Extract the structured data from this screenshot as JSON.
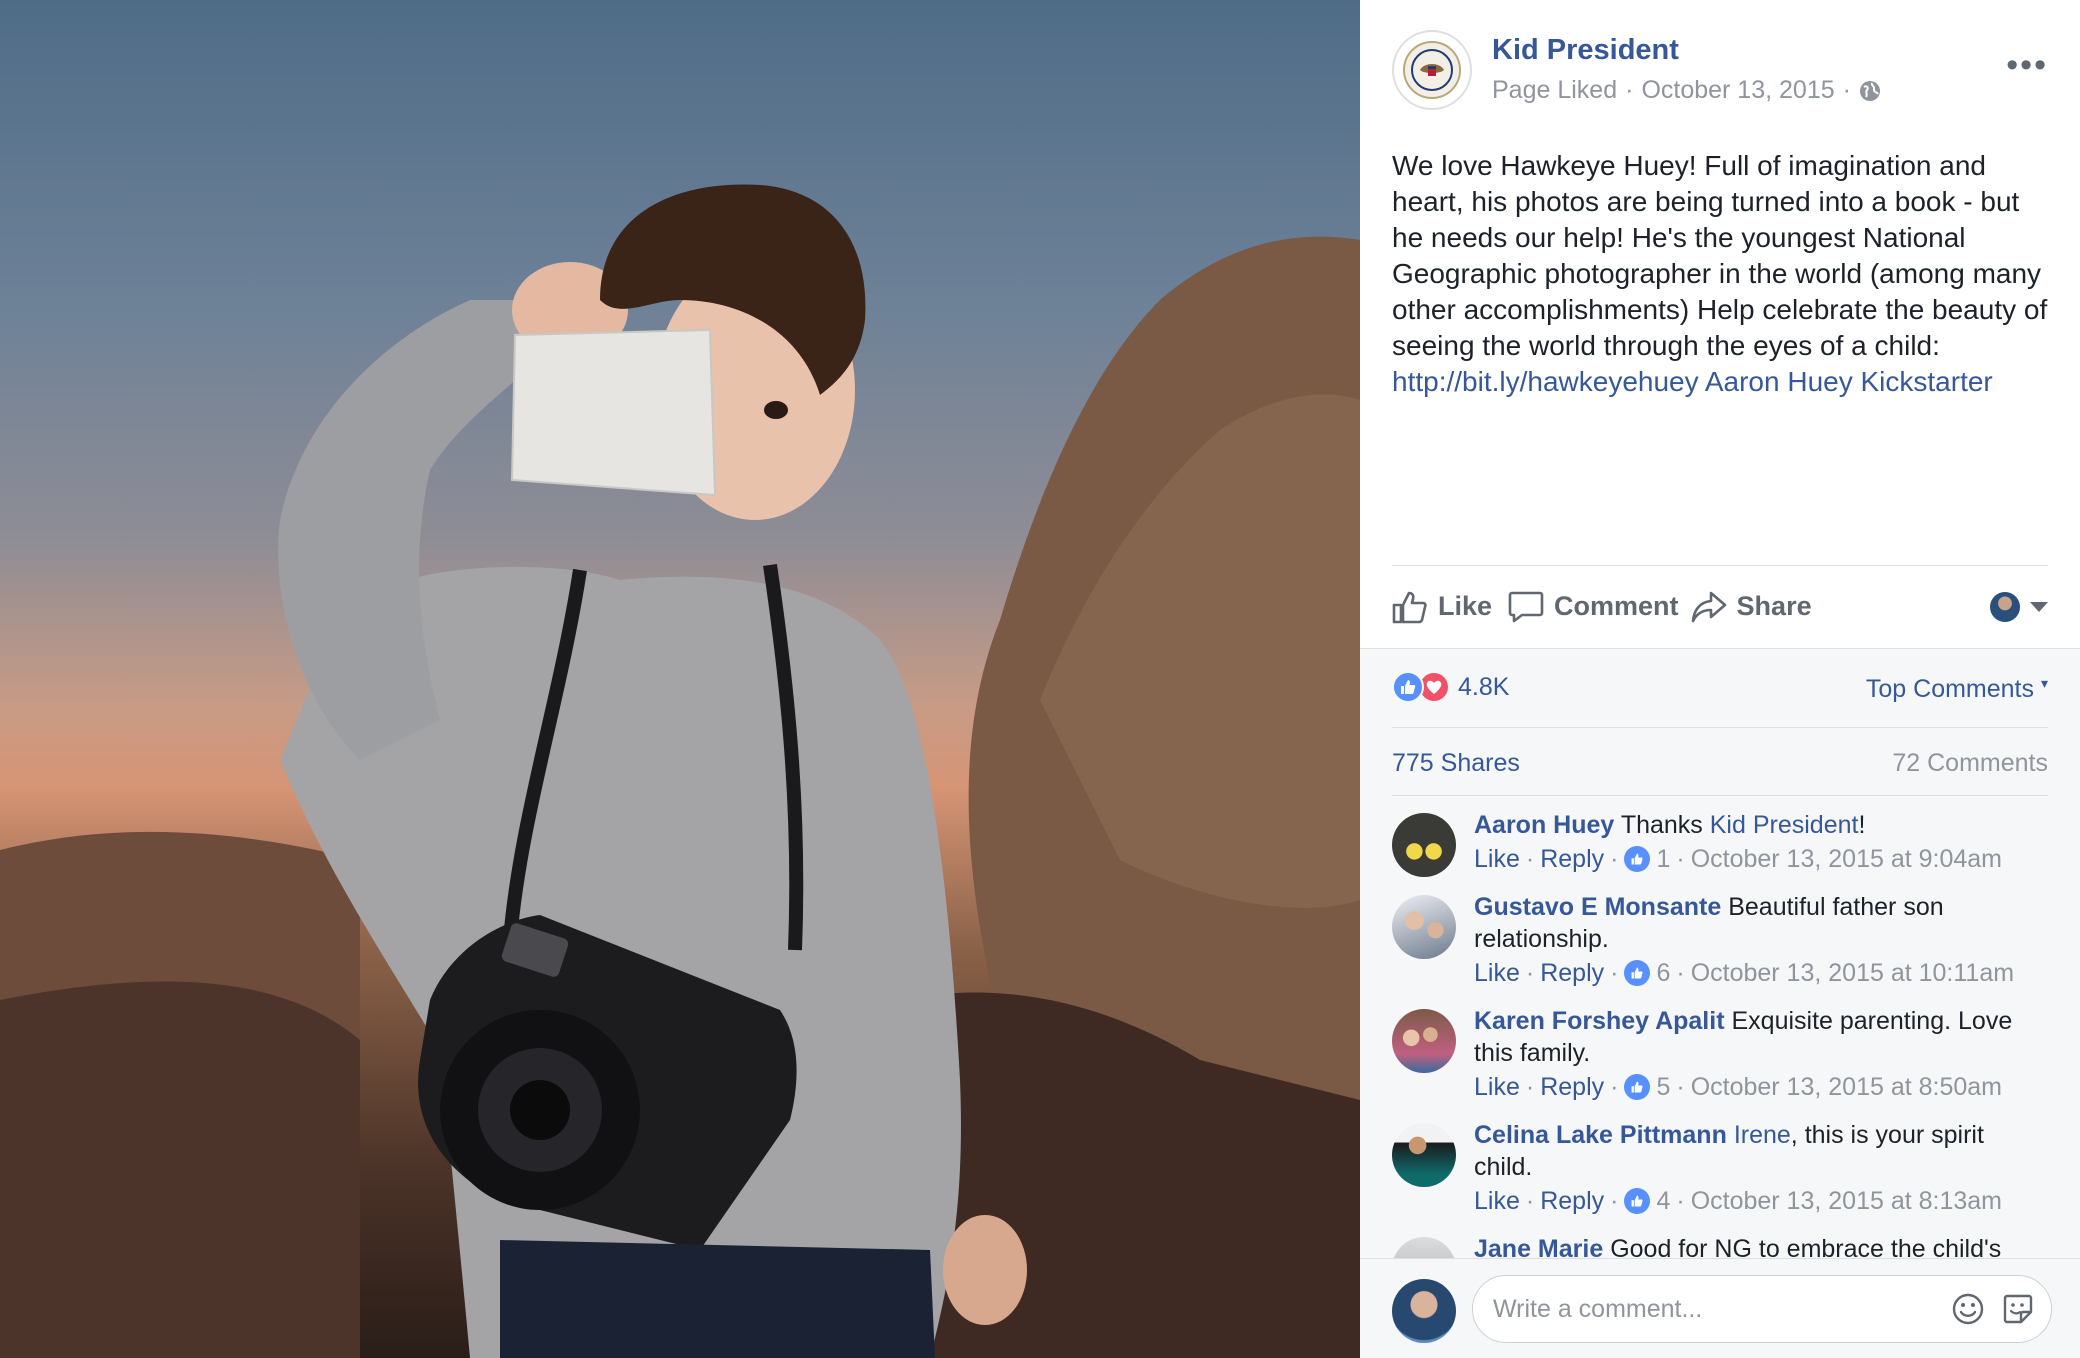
{
  "post": {
    "page_name": "Kid President",
    "meta_status": "Page Liked",
    "meta_sep": "·",
    "date": "October 13, 2015",
    "privacy_icon": "globe-icon",
    "more_label": "•••",
    "text": "We love Hawkeye Huey! Full of imagination and heart, his photos are being turned into a book - but he needs our help! He's the youngest National Geographic photographer in the world (among many other accomplishments) Help celebrate the beauty of seeing the world through the eyes of a child: ",
    "link_url": "http://bit.ly/hawkeyehuey",
    "link_tags": "Aaron Huey Kickstarter"
  },
  "actions": {
    "like": "Like",
    "comment": "Comment",
    "share": "Share"
  },
  "stats": {
    "reactions_count": "4.8K",
    "sort_label": "Top Comments",
    "shares": "775 Shares",
    "comments": "72 Comments"
  },
  "comments": [
    {
      "name": "Aaron Huey",
      "text_before": "Thanks ",
      "mention": "Kid President",
      "text_after": "!",
      "like": "Like",
      "reply": "Reply",
      "likes": "1",
      "time": "October 13, 2015 at 9:04am"
    },
    {
      "name": "Gustavo E Monsante",
      "text_before": "Beautiful father son relationship.",
      "mention": "",
      "text_after": "",
      "like": "Like",
      "reply": "Reply",
      "likes": "6",
      "time": "October 13, 2015 at 10:11am"
    },
    {
      "name": "Karen Forshey Apalit",
      "text_before": "Exquisite parenting. Love this family.",
      "mention": "",
      "text_after": "",
      "like": "Like",
      "reply": "Reply",
      "likes": "5",
      "time": "October 13, 2015 at 8:50am"
    },
    {
      "name": "Celina Lake Pittmann",
      "text_before": "",
      "mention": "Irene",
      "text_after": ", this is your spirit child.",
      "like": "Like",
      "reply": "Reply",
      "likes": "4",
      "time": "October 13, 2015 at 8:13am"
    },
    {
      "name": "Jane Marie",
      "text_before": "Good for NG to embrace the child's",
      "mention": "",
      "text_after": "",
      "like": "",
      "reply": "",
      "likes": "",
      "time": ""
    }
  ],
  "composer": {
    "placeholder": "Write a comment..."
  },
  "colors": {
    "link": "#365899",
    "secondary": "#90949c",
    "like_blue": "#5890ff",
    "love_red": "#f25268"
  }
}
